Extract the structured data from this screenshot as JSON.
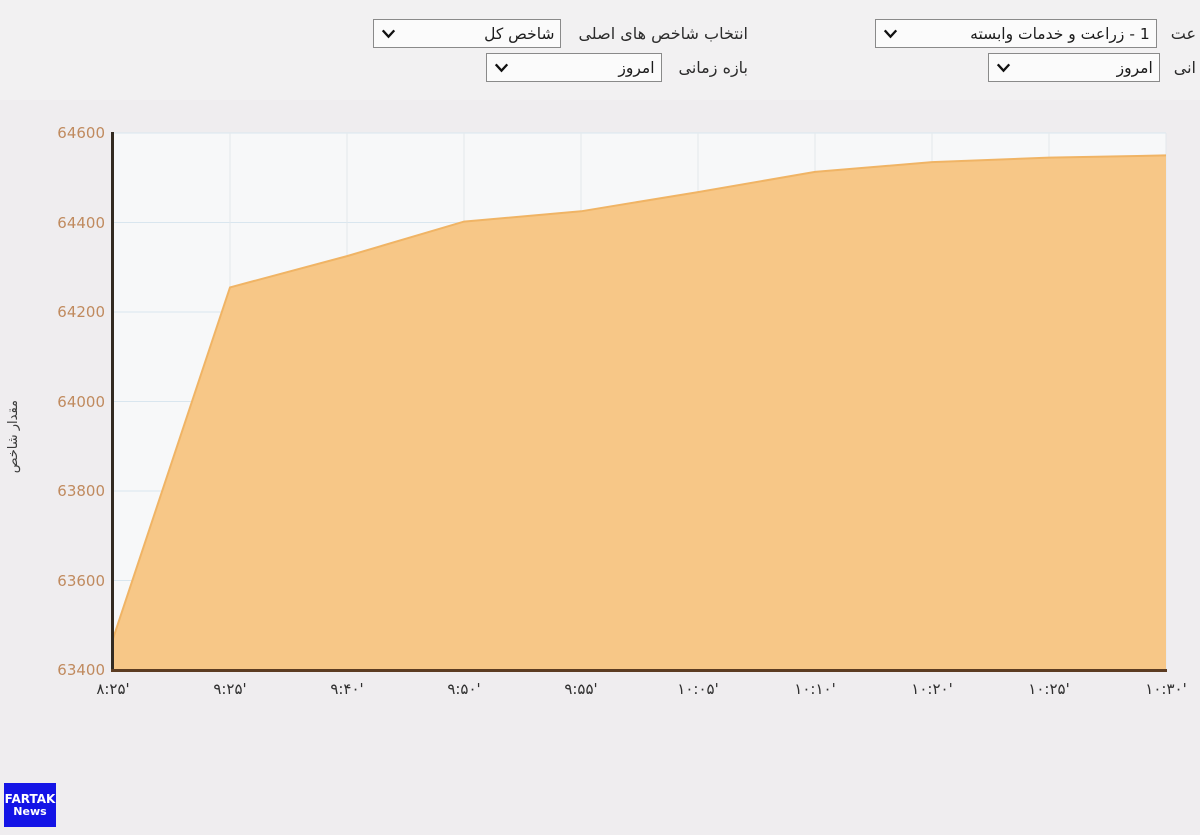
{
  "controls": {
    "right_group": [
      {
        "label": "عت",
        "value": "1 - زراعت و خدمات وابسته"
      },
      {
        "label": "انی",
        "value": "امروز"
      }
    ],
    "left_group": [
      {
        "label": "انتخاب شاخص های اصلی",
        "value": "شاخص کل"
      },
      {
        "label": "بازه زمانی",
        "value": "امروز"
      }
    ],
    "chevron_icon": "chevron-down-icon"
  },
  "watermark": {
    "line1": "FARTAK",
    "line2": "News"
  },
  "chart_data": {
    "type": "area",
    "title": "",
    "xlabel": "",
    "ylabel": "مقدار شاخص",
    "ylim": [
      63400,
      64600
    ],
    "yticks": [
      63400,
      63600,
      63800,
      64000,
      64200,
      64400,
      64600
    ],
    "ytick_labels": [
      "63400",
      "63600",
      "63800",
      "64000",
      "64200",
      "64400",
      "64600"
    ],
    "xtick_labels": [
      "'۸:۲۵",
      "'۹:۲۵",
      "'۹:۴۰",
      "'۹:۵۰",
      "'۹:۵۵",
      "'۱۰:۰۵",
      "'۱۰:۱۰",
      "'۱۰:۲۰",
      "'۱۰:۲۵",
      "'۱۰:۳۰"
    ],
    "grid": true,
    "legend": "none",
    "series": [
      {
        "name": "شاخص کل",
        "fill_color": "#f7c787",
        "line_color": "#f0b465",
        "x": [
          "۸:۲۵",
          "۹:۲۵",
          "۹:۴۰",
          "۹:۵۰",
          "۹:۵۵",
          "۱۰:۰۵",
          "۱۰:۱۰",
          "۱۰:۲۰",
          "۱۰:۲۵",
          "۱۰:۳۰"
        ],
        "values": [
          63470,
          64255,
          64325,
          64402,
          64425,
          64468,
          64513,
          64535,
          64545,
          64550
        ]
      }
    ]
  }
}
